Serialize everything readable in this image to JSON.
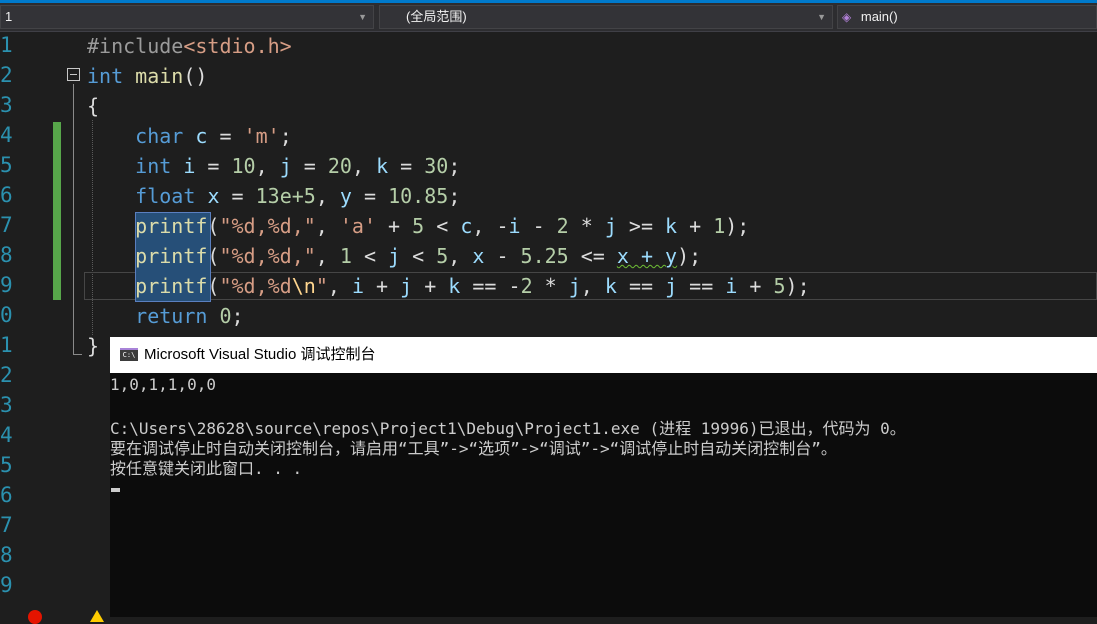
{
  "navbar": {
    "project": "1",
    "scope": "(全局范围)",
    "member": "main()",
    "member_icon": "cube-icon"
  },
  "editor": {
    "line_numbers": [
      "1",
      "2",
      "3",
      "4",
      "5",
      "6",
      "7",
      "8",
      "9",
      "0",
      "1",
      "2",
      "3",
      "4",
      "5",
      "6",
      "7",
      "8",
      "9"
    ],
    "lines": [
      [
        {
          "t": "#include",
          "c": "pre"
        },
        {
          "t": "<stdio.h>",
          "c": "inc"
        }
      ],
      [
        {
          "t": "int",
          "c": "kw"
        },
        {
          "t": " ",
          "c": ""
        },
        {
          "t": "main",
          "c": "fn"
        },
        {
          "t": "()",
          "c": ""
        }
      ],
      [
        {
          "t": "{",
          "c": ""
        }
      ],
      [
        {
          "t": "    ",
          "c": ""
        },
        {
          "t": "char",
          "c": "kw"
        },
        {
          "t": " ",
          "c": ""
        },
        {
          "t": "c",
          "c": "var"
        },
        {
          "t": " = ",
          "c": ""
        },
        {
          "t": "'m'",
          "c": "str"
        },
        {
          "t": ";",
          "c": ""
        }
      ],
      [
        {
          "t": "    ",
          "c": ""
        },
        {
          "t": "int",
          "c": "kw"
        },
        {
          "t": " ",
          "c": ""
        },
        {
          "t": "i",
          "c": "var"
        },
        {
          "t": " = ",
          "c": ""
        },
        {
          "t": "10",
          "c": "num"
        },
        {
          "t": ", ",
          "c": ""
        },
        {
          "t": "j",
          "c": "var"
        },
        {
          "t": " = ",
          "c": ""
        },
        {
          "t": "20",
          "c": "num"
        },
        {
          "t": ", ",
          "c": ""
        },
        {
          "t": "k",
          "c": "var"
        },
        {
          "t": " = ",
          "c": ""
        },
        {
          "t": "30",
          "c": "num"
        },
        {
          "t": ";",
          "c": ""
        }
      ],
      [
        {
          "t": "    ",
          "c": ""
        },
        {
          "t": "float",
          "c": "kw"
        },
        {
          "t": " ",
          "c": ""
        },
        {
          "t": "x",
          "c": "var"
        },
        {
          "t": " = ",
          "c": ""
        },
        {
          "t": "13e+5",
          "c": "num"
        },
        {
          "t": ", ",
          "c": ""
        },
        {
          "t": "y",
          "c": "var"
        },
        {
          "t": " = ",
          "c": ""
        },
        {
          "t": "10.85",
          "c": "num"
        },
        {
          "t": ";",
          "c": ""
        }
      ],
      [
        {
          "t": "    ",
          "c": ""
        },
        {
          "t": "printf",
          "c": "fn"
        },
        {
          "t": "(",
          "c": ""
        },
        {
          "t": "\"%d,%d,\"",
          "c": "str"
        },
        {
          "t": ", ",
          "c": ""
        },
        {
          "t": "'a'",
          "c": "str"
        },
        {
          "t": " + ",
          "c": ""
        },
        {
          "t": "5",
          "c": "num"
        },
        {
          "t": " < ",
          "c": ""
        },
        {
          "t": "c",
          "c": "var"
        },
        {
          "t": ", -",
          "c": ""
        },
        {
          "t": "i",
          "c": "var"
        },
        {
          "t": " - ",
          "c": ""
        },
        {
          "t": "2",
          "c": "num"
        },
        {
          "t": " * ",
          "c": ""
        },
        {
          "t": "j",
          "c": "var"
        },
        {
          "t": " >= ",
          "c": ""
        },
        {
          "t": "k",
          "c": "var"
        },
        {
          "t": " + ",
          "c": ""
        },
        {
          "t": "1",
          "c": "num"
        },
        {
          "t": ");",
          "c": ""
        }
      ],
      [
        {
          "t": "    ",
          "c": ""
        },
        {
          "t": "printf",
          "c": "fn"
        },
        {
          "t": "(",
          "c": ""
        },
        {
          "t": "\"%d,%d,\"",
          "c": "str"
        },
        {
          "t": ", ",
          "c": ""
        },
        {
          "t": "1",
          "c": "num"
        },
        {
          "t": " < ",
          "c": ""
        },
        {
          "t": "j",
          "c": "var"
        },
        {
          "t": " < ",
          "c": ""
        },
        {
          "t": "5",
          "c": "num"
        },
        {
          "t": ", ",
          "c": ""
        },
        {
          "t": "x",
          "c": "var"
        },
        {
          "t": " - ",
          "c": ""
        },
        {
          "t": "5.25",
          "c": "num"
        },
        {
          "t": " <= ",
          "c": ""
        },
        {
          "t": "x + y",
          "c": "var squig"
        },
        {
          "t": ");",
          "c": ""
        }
      ],
      [
        {
          "t": "    ",
          "c": ""
        },
        {
          "t": "printf",
          "c": "fn"
        },
        {
          "t": "(",
          "c": ""
        },
        {
          "t": "\"%d,%d",
          "c": "str"
        },
        {
          "t": "\\n",
          "c": "esc"
        },
        {
          "t": "\"",
          "c": "str"
        },
        {
          "t": ", ",
          "c": ""
        },
        {
          "t": "i",
          "c": "var"
        },
        {
          "t": " + ",
          "c": ""
        },
        {
          "t": "j",
          "c": "var"
        },
        {
          "t": " + ",
          "c": ""
        },
        {
          "t": "k",
          "c": "var"
        },
        {
          "t": " == -",
          "c": ""
        },
        {
          "t": "2",
          "c": "num"
        },
        {
          "t": " * ",
          "c": ""
        },
        {
          "t": "j",
          "c": "var"
        },
        {
          "t": ", ",
          "c": ""
        },
        {
          "t": "k",
          "c": "var"
        },
        {
          "t": " == ",
          "c": ""
        },
        {
          "t": "j",
          "c": "var"
        },
        {
          "t": " == ",
          "c": ""
        },
        {
          "t": "i",
          "c": "var"
        },
        {
          "t": " + ",
          "c": ""
        },
        {
          "t": "5",
          "c": "num"
        },
        {
          "t": ");",
          "c": ""
        }
      ],
      [
        {
          "t": "    ",
          "c": ""
        },
        {
          "t": "return",
          "c": "kw"
        },
        {
          "t": " ",
          "c": ""
        },
        {
          "t": "0",
          "c": "num"
        },
        {
          "t": ";",
          "c": ""
        }
      ],
      [
        {
          "t": "}",
          "c": ""
        }
      ]
    ]
  },
  "console": {
    "title": "Microsoft Visual Studio 调试控制台",
    "icon_label": "C:\\",
    "lines": [
      "1,0,1,1,0,0",
      "",
      "C:\\Users\\28628\\source\\repos\\Project1\\Debug\\Project1.exe (进程 19996)已退出，代码为 0。",
      "要在调试停止时自动关闭控制台，请启用“工具”->“选项”->“调试”->“调试停止时自动关闭控制台”。",
      "按任意键关闭此窗口. . ."
    ]
  },
  "colors": {
    "editor_bg": "#1e1e1e",
    "keyword": "#569cd6",
    "function": "#dcdcaa",
    "string": "#d69d85",
    "number": "#b5cea8",
    "variable": "#9cdcfe",
    "line_number": "#2b91af",
    "change_bar": "#57a64a",
    "console_bg": "#0c0c0c"
  }
}
